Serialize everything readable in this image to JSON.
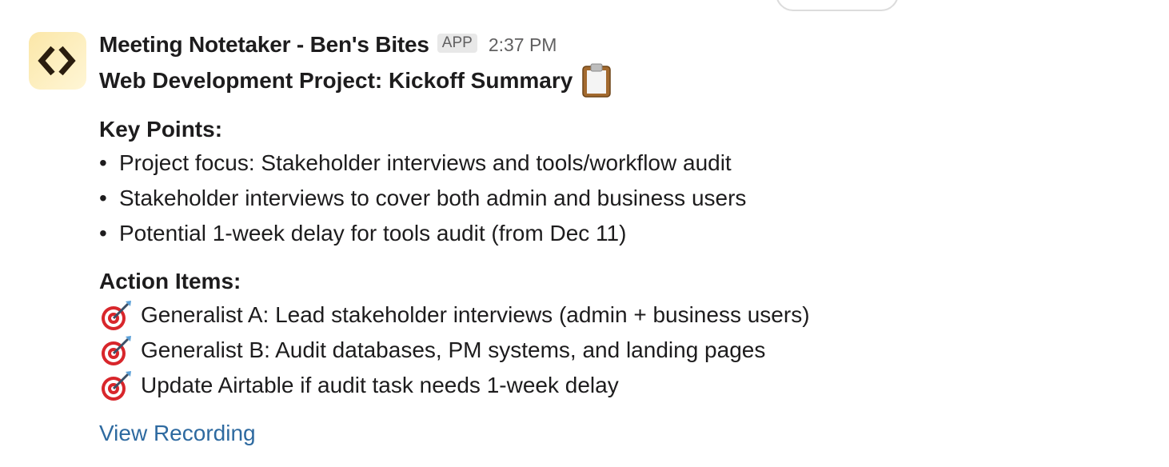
{
  "message": {
    "sender": "Meeting Notetaker - Ben's Bites",
    "badge": "APP",
    "time": "2:37 PM",
    "title": "Web Development Project: Kickoff Summary",
    "title_emoji": "clipboard-icon"
  },
  "key_points": {
    "heading": "Key Points:",
    "bullet_char": "•",
    "items": [
      "Project focus: Stakeholder interviews and tools/workflow audit",
      "Stakeholder interviews to cover both admin and business users",
      "Potential 1-week delay for tools audit (from Dec 11)"
    ]
  },
  "action_items": {
    "heading": "Action Items:",
    "icon": "target-icon",
    "items": [
      "Generalist A: Lead stakeholder interviews (admin + business users)",
      "Generalist B: Audit databases, PM systems, and landing pages",
      "Update Airtable if audit task needs 1-week delay"
    ]
  },
  "link": {
    "label": "View Recording"
  },
  "colors": {
    "text": "#1d1c1d",
    "muted": "#616061",
    "link": "#2e6aa0",
    "avatar_bg": "#fbe7a8"
  }
}
